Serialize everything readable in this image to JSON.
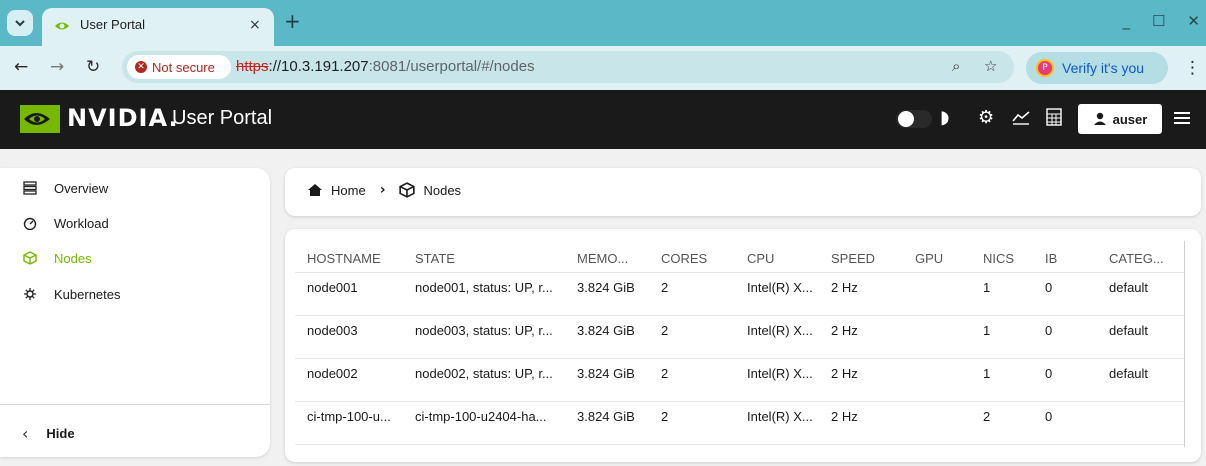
{
  "browser": {
    "tab_title": "User Portal",
    "tab_close": "×",
    "new_tab": "+",
    "security_chip": "Not secure",
    "url_scheme": "https",
    "url_host": "://10.3.191.207",
    "url_rest": ":8081/userportal/#/nodes",
    "verify_label": "Verify it's you",
    "window_controls": [
      "_",
      "☐",
      "✕"
    ]
  },
  "app": {
    "brand": "NVIDIA.",
    "title": "User Portal",
    "user": "auser",
    "colors": {
      "accent": "#76b900",
      "header_bg": "#1a1a1a"
    }
  },
  "sidebar": {
    "items": [
      {
        "label": "Overview",
        "icon": "overview-icon"
      },
      {
        "label": "Workload",
        "icon": "workload-icon"
      },
      {
        "label": "Nodes",
        "icon": "nodes-icon",
        "active": true
      },
      {
        "label": "Kubernetes",
        "icon": "kubernetes-icon"
      }
    ],
    "hide_label": "Hide"
  },
  "breadcrumb": {
    "home": "Home",
    "current": "Nodes"
  },
  "table": {
    "columns": [
      "HOSTNAME",
      "STATE",
      "MEMO...",
      "CORES",
      "CPU",
      "SPEED",
      "GPU",
      "NICS",
      "IB",
      "CATEG..."
    ],
    "rows": [
      [
        "node001",
        "node001, status: UP, r...",
        "3.824 GiB",
        "2",
        "Intel(R) X...",
        "2 Hz",
        "",
        "1",
        "0",
        "default"
      ],
      [
        "node003",
        "node003, status: UP, r...",
        "3.824 GiB",
        "2",
        "Intel(R) X...",
        "2 Hz",
        "",
        "1",
        "0",
        "default"
      ],
      [
        "node002",
        "node002, status: UP, r...",
        "3.824 GiB",
        "2",
        "Intel(R) X...",
        "2 Hz",
        "",
        "1",
        "0",
        "default"
      ],
      [
        "ci-tmp-100-u...",
        "ci-tmp-100-u2404-ha...",
        "3.824 GiB",
        "2",
        "Intel(R) X...",
        "2 Hz",
        "",
        "2",
        "0",
        ""
      ]
    ]
  }
}
